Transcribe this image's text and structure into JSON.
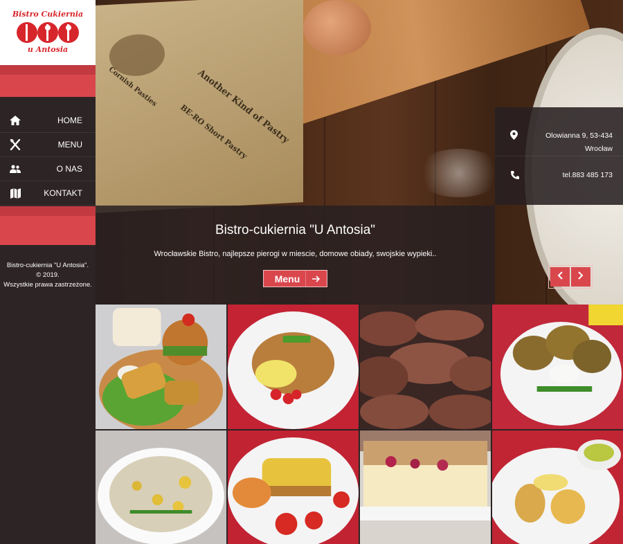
{
  "brand": {
    "logo_line1": "Bistro Cukiernia",
    "logo_line2": "u Antosia",
    "accent": "#d9474d"
  },
  "nav": {
    "items": [
      {
        "label": "HOME",
        "icon": "home-icon"
      },
      {
        "label": "MENU",
        "icon": "cutlery-icon"
      },
      {
        "label": "O NAS",
        "icon": "users-icon"
      },
      {
        "label": "KONTAKT",
        "icon": "map-icon"
      }
    ]
  },
  "footer": {
    "line1": "Bistro-cukiernia \"U Antosia\".",
    "line2": "© 2019.",
    "line3": "Wszystkie prawa zastrzeżone."
  },
  "hero": {
    "title_prefix": "Bistro-cukiernia ",
    "title_quote": "\"U Antosia\"",
    "description": "Wrocławskie Bistro, najlepsze pierogi w miescie, domowe obiady, swojskie wypieki..",
    "button_label": "Menu",
    "book_text": [
      "Cornish Pasties",
      "Another Kind of Pastry",
      "BE-RO Short Pastry"
    ]
  },
  "contact": {
    "address_line1": "Olowianna 9, 53-434",
    "address_line2": "Wrocław",
    "phone": "tel.883 485 173"
  },
  "gallery": {
    "items": [
      {
        "name": "burger-potato-plate"
      },
      {
        "name": "chicken-vegetable-plate"
      },
      {
        "name": "chocolate-cookies"
      },
      {
        "name": "potato-pancakes"
      },
      {
        "name": "mushroom-soup"
      },
      {
        "name": "lasagna-plate"
      },
      {
        "name": "cheesecake"
      },
      {
        "name": "breaded-cutlets"
      }
    ]
  }
}
